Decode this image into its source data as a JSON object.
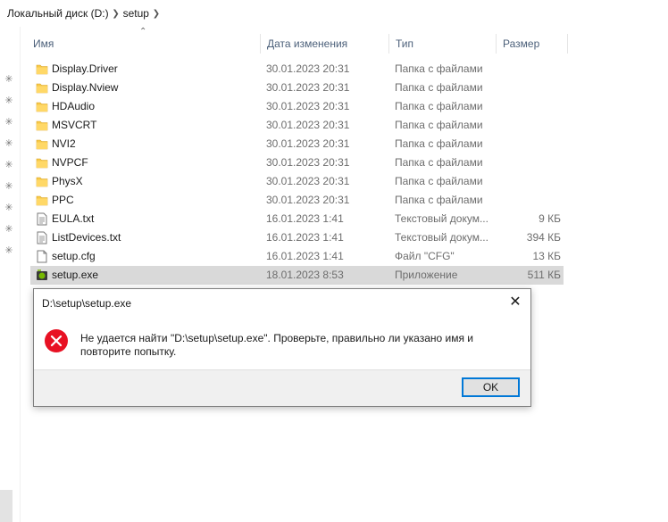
{
  "breadcrumb": [
    "Локальный диск (D:)",
    "setup"
  ],
  "columns": {
    "name": "Имя",
    "date": "Дата изменения",
    "type": "Тип",
    "size": "Размер"
  },
  "files": [
    {
      "name": "Display.Driver",
      "date": "30.01.2023 20:31",
      "type": "Папка с файлами",
      "size": "",
      "icon": "folder-icon"
    },
    {
      "name": "Display.Nview",
      "date": "30.01.2023 20:31",
      "type": "Папка с файлами",
      "size": "",
      "icon": "folder-icon"
    },
    {
      "name": "HDAudio",
      "date": "30.01.2023 20:31",
      "type": "Папка с файлами",
      "size": "",
      "icon": "folder-icon"
    },
    {
      "name": "MSVCRT",
      "date": "30.01.2023 20:31",
      "type": "Папка с файлами",
      "size": "",
      "icon": "folder-icon"
    },
    {
      "name": "NVI2",
      "date": "30.01.2023 20:31",
      "type": "Папка с файлами",
      "size": "",
      "icon": "folder-icon"
    },
    {
      "name": "NVPCF",
      "date": "30.01.2023 20:31",
      "type": "Папка с файлами",
      "size": "",
      "icon": "folder-icon"
    },
    {
      "name": "PhysX",
      "date": "30.01.2023 20:31",
      "type": "Папка с файлами",
      "size": "",
      "icon": "folder-icon"
    },
    {
      "name": "PPC",
      "date": "30.01.2023 20:31",
      "type": "Папка с файлами",
      "size": "",
      "icon": "folder-icon"
    },
    {
      "name": "EULA.txt",
      "date": "16.01.2023 1:41",
      "type": "Текстовый докум...",
      "size": "9 КБ",
      "icon": "text-file-icon"
    },
    {
      "name": "ListDevices.txt",
      "date": "16.01.2023 1:41",
      "type": "Текстовый докум...",
      "size": "394 КБ",
      "icon": "text-file-icon"
    },
    {
      "name": "setup.cfg",
      "date": "16.01.2023 1:41",
      "type": "Файл \"CFG\"",
      "size": "13 КБ",
      "icon": "file-icon"
    },
    {
      "name": "setup.exe",
      "date": "18.01.2023 8:53",
      "type": "Приложение",
      "size": "511 КБ",
      "icon": "app-icon",
      "selected": true
    }
  ],
  "dialog": {
    "title": "D:\\setup\\setup.exe",
    "message": "Не удается найти \"D:\\setup\\setup.exe\". Проверьте, правильно ли указано имя и повторите попытку.",
    "ok_label": "OK",
    "close_glyph": "✕",
    "icon": "error-icon"
  },
  "colors": {
    "selected_row": "#d9d9d9",
    "folder": "#f7c948",
    "error": "#e81123",
    "accent": "#0078d7"
  }
}
